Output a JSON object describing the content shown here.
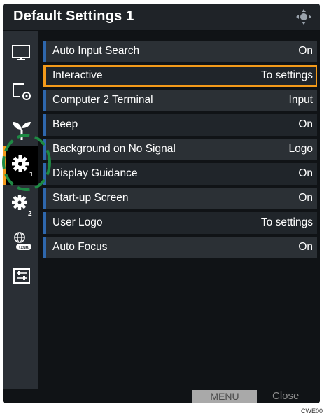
{
  "window": {
    "title": "Default Settings 1"
  },
  "sidebar": {
    "items": [
      {
        "icon": "monitor-icon"
      },
      {
        "icon": "display-settings-icon"
      },
      {
        "icon": "eco-plant-icon"
      },
      {
        "icon": "gear-1-icon",
        "badge": "1",
        "active": true
      },
      {
        "icon": "gear-2-icon",
        "badge": "2"
      },
      {
        "icon": "network-usb-icon",
        "badge": "USB"
      },
      {
        "icon": "control-panel-icon"
      }
    ]
  },
  "menu": {
    "rows": [
      {
        "label": "Auto Input Search",
        "value": "On"
      },
      {
        "label": "Interactive",
        "value": "To settings",
        "selected": true
      },
      {
        "label": "Computer 2 Terminal",
        "value": "Input"
      },
      {
        "label": "Beep",
        "value": "On"
      },
      {
        "label": "Background on No Signal",
        "value": "Logo"
      },
      {
        "label": "Display Guidance",
        "value": "On"
      },
      {
        "label": "Start-up Screen",
        "value": "On"
      },
      {
        "label": "User Logo",
        "value": "To settings"
      },
      {
        "label": "Auto Focus",
        "value": "On"
      }
    ]
  },
  "footer": {
    "menu_label": "MENU",
    "close_label": "Close"
  },
  "figure_code": "CWE00",
  "colors": {
    "accent": "#f39a1a",
    "row_bar": "#2e67ad",
    "highlight": "#1e8a44"
  }
}
